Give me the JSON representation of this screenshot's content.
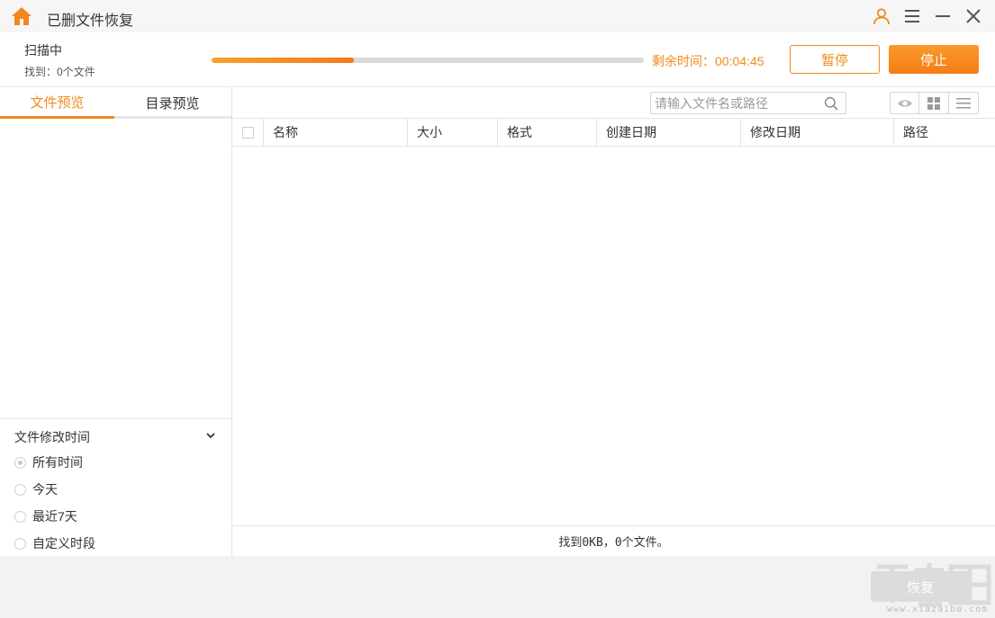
{
  "window": {
    "title": "已删文件恢复",
    "icons": [
      "home-icon",
      "user-icon",
      "menu-icon",
      "minimize-icon",
      "close-icon"
    ]
  },
  "scan": {
    "status": "扫描中",
    "found": "找到：0个文件",
    "progress": 0.33,
    "remaining": "剩余时间：00:04:45",
    "pause_label": "暂停",
    "stop_label": "停止"
  },
  "left_panel": {
    "tabs": [
      {
        "label": "文件预览",
        "active": true
      },
      {
        "label": "目录预览",
        "active": false
      }
    ],
    "filter": {
      "title": "文件修改时间",
      "options": [
        {
          "label": "所有时间",
          "checked": true
        },
        {
          "label": "今天",
          "checked": false
        },
        {
          "label": "最近7天",
          "checked": false
        },
        {
          "label": "自定义时段",
          "checked": false
        }
      ]
    }
  },
  "main": {
    "search": {
      "placeholder": "请输入文件名或路径",
      "value": ""
    },
    "view_buttons": [
      "eye-icon",
      "grid-icon",
      "list-icon"
    ],
    "columns": [
      "名称",
      "大小",
      "格式",
      "创建日期",
      "修改日期",
      "路径"
    ],
    "rows": [],
    "status": "找到0KB，0个文件。"
  },
  "footer": {
    "recover_label": "恢复",
    "watermark": "www.xiazaiba.com"
  },
  "colors": {
    "accent": "#f08a1e",
    "track": "#d9d9d9"
  }
}
